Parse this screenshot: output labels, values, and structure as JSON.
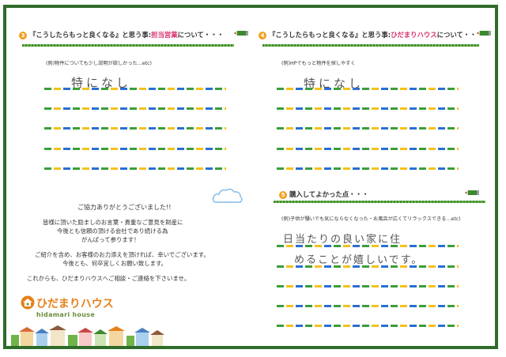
{
  "q3": {
    "number": "3",
    "title_pre": "『こうしたらもっと良くなる』と思う事:",
    "title_highlight": "担当営業",
    "title_post": "について・・・",
    "hint": "(例)物件についても少し説明が欲しかった…etc)",
    "answer": "特になし"
  },
  "q4": {
    "number": "4",
    "title_pre": "『こうしたらもっと良くなる』と思う事:",
    "title_highlight": "ひだまりハウス",
    "title_post": "について・・・",
    "hint": "(例)HPでもっと物件を探しやすく",
    "answer": "特になし"
  },
  "q5": {
    "number": "5",
    "title": "購入してよかった点・・・",
    "hint": "(例)子供が騒いでも気にならなくなった・お風呂が広くてリラックスできる…etc)",
    "answer_line1": "日当たりの良い家に住",
    "answer_line2": "めることが嬉しいです。"
  },
  "thanks": {
    "line1": "ご協力ありがとうございました!!",
    "line2": "皆様に頂いた励ましのお言葉・貴重なご意見を財産に",
    "line3": "今後とも信頼の頂ける会社であり続ける為",
    "line4": "がんばって参ります！",
    "line5": "ご紹介を含め、お客様のお力添えを頂ければ、幸いでございます。",
    "line6": "今後とも、何卒宜しくお願い致します。",
    "line7": "これからも、ひだまりハウスへご相談・ご連絡を下さいませ。"
  },
  "logo": {
    "name": "ひだまりハウス",
    "sub": "hidamari house"
  },
  "colors": {
    "frame": "#2f6b2a",
    "accent_orange": "#f0a020",
    "highlight_pink": "#d83070",
    "dash_green": "#3a9e3a",
    "dash_yellow": "#f2c21b",
    "dash_blue": "#2a6fd0"
  }
}
